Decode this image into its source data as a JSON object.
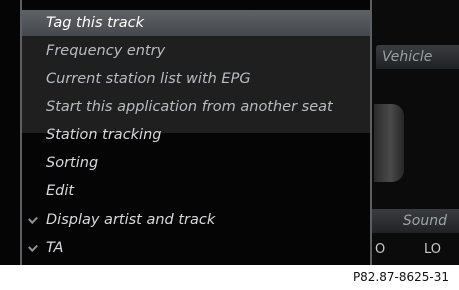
{
  "background": {
    "vehicle_label": "Vehicle",
    "sound_label": "Sound",
    "lo_left": "O",
    "lo_right": "LO"
  },
  "menu": {
    "items": [
      {
        "label": "Tag this track",
        "selected": true,
        "checked": false
      },
      {
        "label": "Frequency entry",
        "selected": false,
        "checked": false
      },
      {
        "label": "Current station list with EPG",
        "selected": false,
        "checked": false
      },
      {
        "label": "Start this application from another seat",
        "selected": false,
        "checked": false
      },
      {
        "label": "Station tracking",
        "selected": false,
        "checked": false
      },
      {
        "label": "Sorting",
        "selected": false,
        "checked": false
      },
      {
        "label": "Edit",
        "selected": false,
        "checked": false
      },
      {
        "label": "Display artist and track",
        "selected": false,
        "checked": true
      },
      {
        "label": "TA",
        "selected": false,
        "checked": true
      }
    ]
  },
  "caption": "P82.87-8625-31",
  "colors": {
    "selection": "#5e6266",
    "text": "#d7d9db",
    "background": "#050505"
  }
}
